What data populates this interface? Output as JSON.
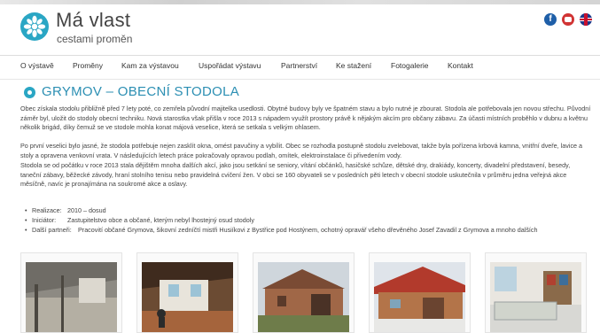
{
  "site": {
    "title": "Má vlast",
    "subtitle": "cestami proměn"
  },
  "social": {
    "facebook_glyph": "f",
    "youtube": "youtube-icon",
    "language": "uk-flag-icon"
  },
  "nav": [
    "O výstavě",
    "Proměny",
    "Kam za výstavou",
    "Uspořádat výstavu",
    "Partnerství",
    "Ke stažení",
    "Fotogalerie",
    "Kontakt"
  ],
  "page": {
    "title": "GRYMOV – OBECNÍ STODOLA",
    "paragraphs": [
      "Obec získala stodolu přibližně před 7 lety poté, co zemřela původní majitelka usedlosti. Obytné budovy byly ve špatném stavu a bylo nutné je zbourat. Stodola ale potřebovala jen novou střechu. Původní záměr byl, uložit do stodoly obecní techniku. Nová starostka však přišla v roce 2013 s nápadem využít prostory právě k nějakým akcím pro občany zábavu. Za účasti místních proběhlo v dubnu a květnu několik brigád, díky čemuž se ve stodole mohla konat májová veselice, která se setkala s velkým ohlasem.",
      "Po první veselici bylo jasné, že stodola potřebuje nejen zasklít okna, omést pavučiny a vybílit. Obec se rozhodla postupně stodolu zvelebovat, takže byla pořízena krbová kamna, vnitřní dveře, lavice a stoly a opravena venkovní vrata. V následujících letech práce pokračovaly opravou podlah, omítek, elektroinstalace či přivedením vody.",
      "Stodola se od počátku v roce 2013 stala dějištěm mnoha dalších akcí, jako jsou setkání se seniory, vítání občánků, hasičské schůze, dětské dny, drakiády, koncerty, divadelní představení, besedy, taneční zábavy, běžecké závody, hraní stolního tenisu nebo pravidelná cvičení žen. V obci se 160 obyvateli se v posledních pěti letech v obecní stodole uskutečnila v průměru jedna veřejná akce měsíčně, navíc je pronajímána na soukromé akce a oslavy."
    ],
    "facts": [
      {
        "label": "Realizace:",
        "value": "2010 – dosud"
      },
      {
        "label": "Iniciátor:",
        "value": "Zastupitelstvo obce a občané, kterým nebyl lhostejný osud stodoly"
      },
      {
        "label": "Další partneři:",
        "value": "Pracovití občané Grymova, šikovní zedníčtí mistři Husiíkovi z Bystřice pod Hostýnem, ochotný opravář všeho dřevěného Josef Zavadil z Grymova a mnoho dalších"
      }
    ]
  },
  "gallery": [
    "photo-barn-interior-old",
    "photo-barn-interior-renovated",
    "photo-barn-exterior-old",
    "photo-barn-exterior-new",
    "photo-barn-kitchen"
  ],
  "colors": {
    "accent": "#2c8fb3",
    "logo": "#2aa6c4"
  }
}
